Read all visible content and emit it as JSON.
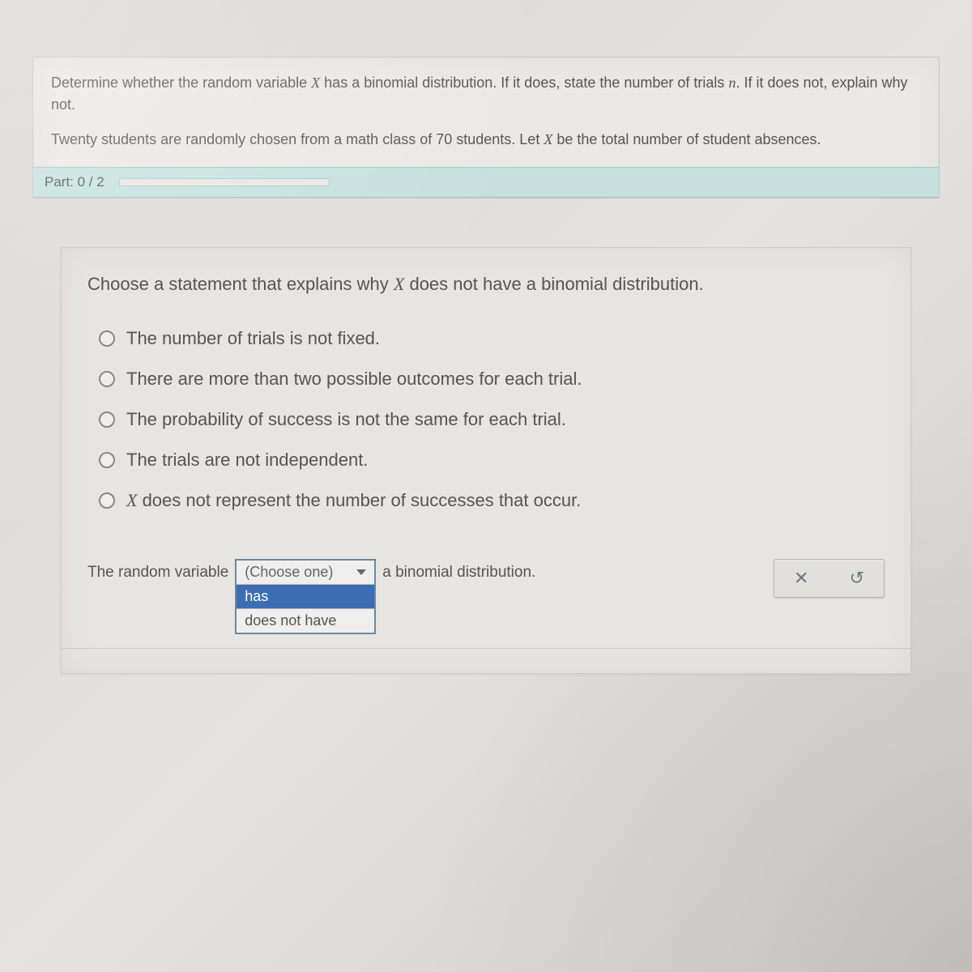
{
  "question": {
    "prompt_part1": "Determine whether the random variable ",
    "var1": "X",
    "prompt_part2": " has a binomial distribution. If it does, state the number of trials ",
    "var2": "n",
    "prompt_part3": ". If it does not, explain why not.",
    "scenario_part1": "Twenty students are randomly chosen from a math class of ",
    "scenario_num": "70",
    "scenario_part2": " students. Let ",
    "scenario_var": "X",
    "scenario_part3": " be the total number of student absences."
  },
  "part": {
    "label": "Part: 0 / 2"
  },
  "subq": {
    "text_part1": "Choose a statement that explains why ",
    "var": "X",
    "text_part2": " does not have a binomial distribution."
  },
  "options": [
    "The number of trials is not fixed.",
    "There are more than two possible outcomes for each trial.",
    "The probability of success is not the same for each trial.",
    "The trials are not independent.",
    "X does not represent the number of successes that occur."
  ],
  "bottom": {
    "lead": "The random variable",
    "dropdown_placeholder": "(Choose one)",
    "opt1": "has",
    "opt2": "does not have",
    "tail": "a binomial distribution."
  }
}
